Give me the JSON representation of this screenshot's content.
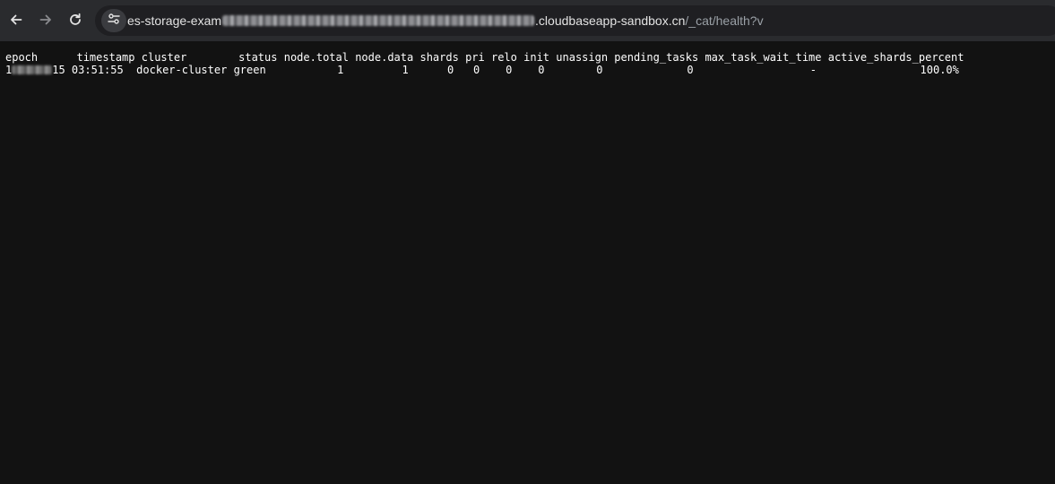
{
  "toolbar": {
    "back_icon": "arrow-left-icon",
    "forward_icon": "arrow-right-icon",
    "reload_icon": "reload-icon",
    "site_info_icon": "tune-icon"
  },
  "omnibox": {
    "url_prefix": "es-storage-exam",
    "url_domain": ".cloudbaseapp-sandbox.cn",
    "url_path": "/_cat/health?v"
  },
  "health": {
    "columns": [
      "epoch",
      "timestamp",
      "cluster",
      "status",
      "node.total",
      "node.data",
      "shards",
      "pri",
      "relo",
      "init",
      "unassign",
      "pending_tasks",
      "max_task_wait_time",
      "active_shards_percent"
    ],
    "row": {
      "epoch_prefix": "1",
      "epoch_suffix": "15",
      "timestamp": "03:51:55",
      "cluster": "docker-cluster",
      "status": "green",
      "node_total": "1",
      "node_data": "1",
      "shards": "0",
      "pri": "0",
      "relo": "0",
      "init": "0",
      "unassign": "0",
      "pending_tasks": "0",
      "max_task_wait_time": "-",
      "active_shards_percent": "100.0%"
    }
  },
  "colors": {
    "toolbar_bg": "#2a2b2e",
    "omnibox_bg": "#1f1f22",
    "page_bg": "#121212",
    "text": "#ffffff",
    "path_text": "#9aa0a6"
  }
}
